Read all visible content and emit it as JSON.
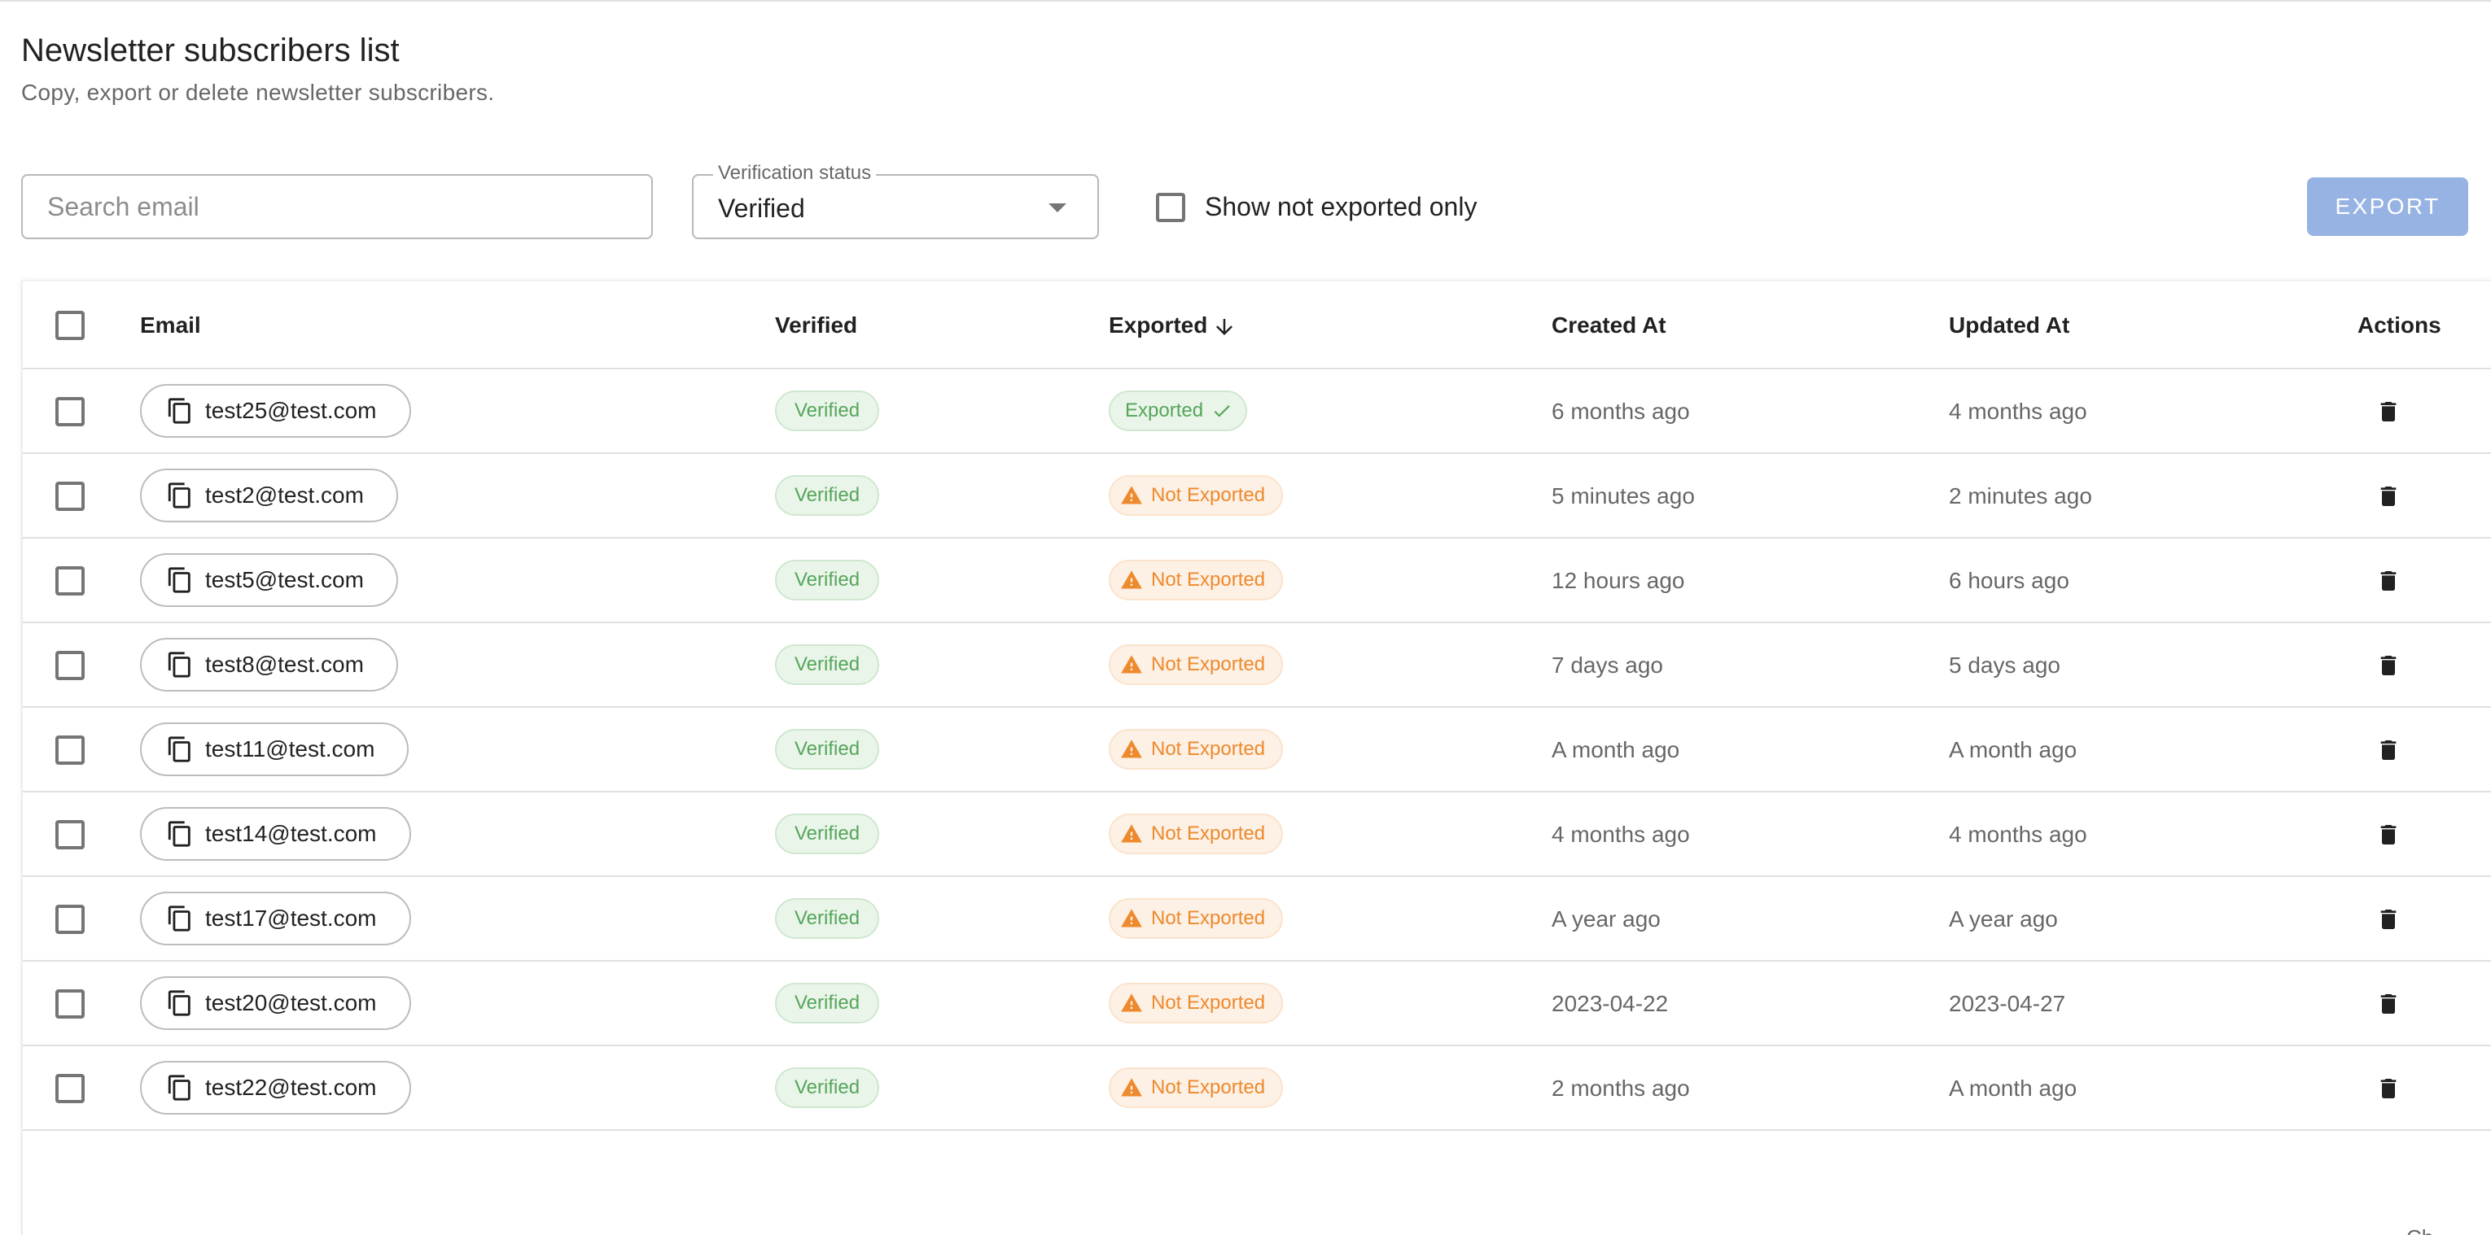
{
  "header": {
    "title": "Newsletter subscribers list",
    "subtitle": "Copy, export or delete newsletter subscribers."
  },
  "toolbar": {
    "search_placeholder": "Search email",
    "search_value": "",
    "verification_label": "Verification status",
    "verification_value": "Verified",
    "show_not_exported_label": "Show not exported only",
    "show_not_exported_checked": false,
    "export_label": "EXPORT"
  },
  "table": {
    "columns": {
      "email": "Email",
      "verified": "Verified",
      "exported": "Exported",
      "created": "Created At",
      "updated": "Updated At",
      "actions": "Actions"
    },
    "sort": {
      "column": "Exported",
      "direction": "descending"
    },
    "rows": [
      {
        "email": "test25@test.com",
        "verified": "Verified",
        "exported": "Exported",
        "exported_state": "exported",
        "created": "6 months ago",
        "updated": "4 months ago"
      },
      {
        "email": "test2@test.com",
        "verified": "Verified",
        "exported": "Not Exported",
        "exported_state": "not_exported",
        "created": "5 minutes ago",
        "updated": "2 minutes ago"
      },
      {
        "email": "test5@test.com",
        "verified": "Verified",
        "exported": "Not Exported",
        "exported_state": "not_exported",
        "created": "12 hours ago",
        "updated": "6 hours ago"
      },
      {
        "email": "test8@test.com",
        "verified": "Verified",
        "exported": "Not Exported",
        "exported_state": "not_exported",
        "created": "7 days ago",
        "updated": "5 days ago"
      },
      {
        "email": "test11@test.com",
        "verified": "Verified",
        "exported": "Not Exported",
        "exported_state": "not_exported",
        "created": "A month ago",
        "updated": "A month ago"
      },
      {
        "email": "test14@test.com",
        "verified": "Verified",
        "exported": "Not Exported",
        "exported_state": "not_exported",
        "created": "4 months ago",
        "updated": "4 months ago"
      },
      {
        "email": "test17@test.com",
        "verified": "Verified",
        "exported": "Not Exported",
        "exported_state": "not_exported",
        "created": "A year ago",
        "updated": "A year ago"
      },
      {
        "email": "test20@test.com",
        "verified": "Verified",
        "exported": "Not Exported",
        "exported_state": "not_exported",
        "created": "2023-04-22",
        "updated": "2023-04-27"
      },
      {
        "email": "test22@test.com",
        "verified": "Verified",
        "exported": "Not Exported",
        "exported_state": "not_exported",
        "created": "2 months ago",
        "updated": "A month ago"
      }
    ]
  },
  "footer": {
    "fragment": "Ch"
  },
  "colors": {
    "export_button": "#97b3e3",
    "verified_text": "#55a55a",
    "verified_bg": "#eaf5ea",
    "not_exported_text": "#ed8a2e",
    "not_exported_bg": "#fdf0e4"
  },
  "icons": {
    "email_chip": "copy-icon",
    "exported_chip": "check-icon",
    "not_exported_chip": "warning-icon",
    "row_action": "trash-icon",
    "sort": "arrow-down-icon",
    "select": "caret-down-icon"
  }
}
